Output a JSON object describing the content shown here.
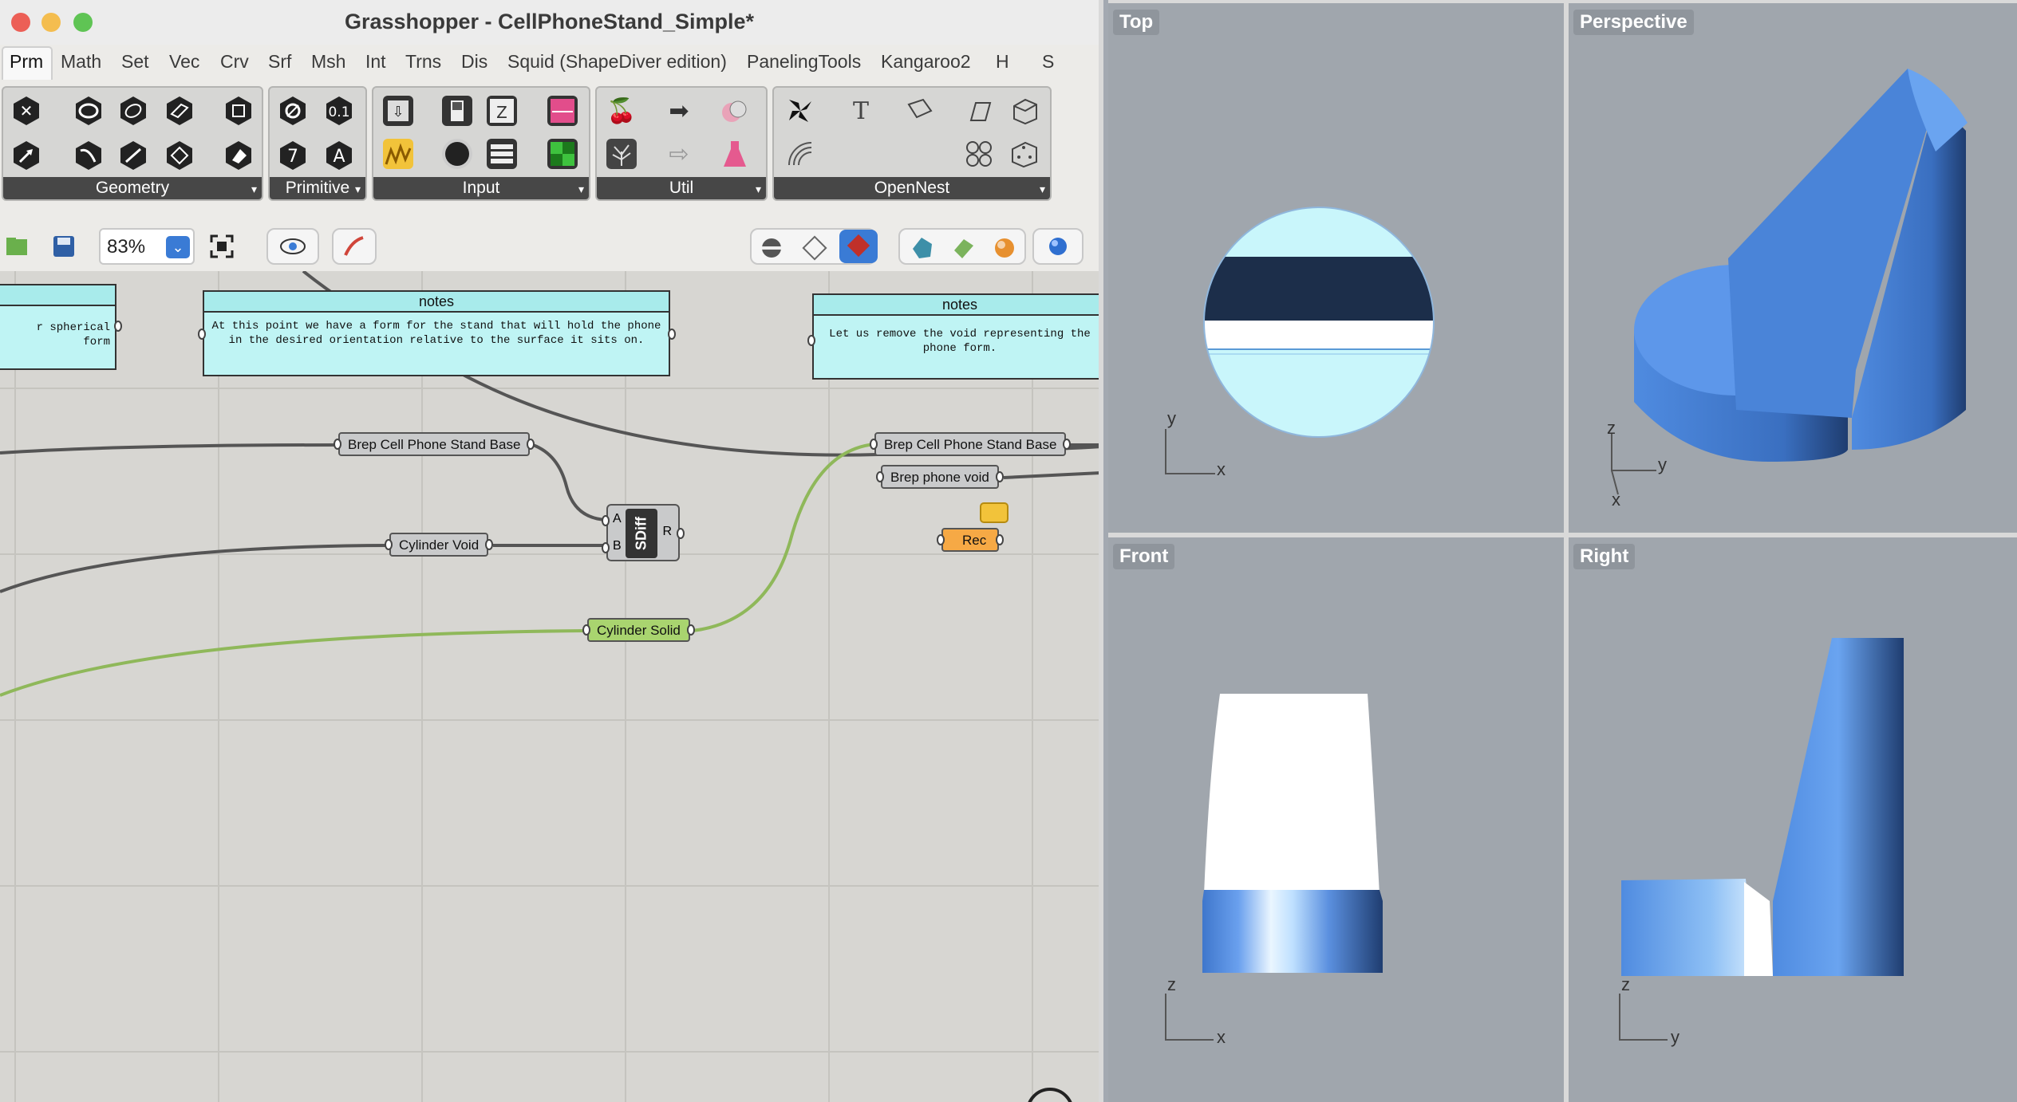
{
  "window": {
    "title": "Grasshopper - CellPhoneStand_Simple*",
    "traffic_colors": [
      "#ec5f56",
      "#f4bd4f",
      "#5fc454"
    ]
  },
  "menu": {
    "tabs": [
      "Prm",
      "Math",
      "Set",
      "Vec",
      "Crv",
      "Srf",
      "Msh",
      "Int",
      "Trns",
      "Dis",
      "Squid (ShapeDiver edition)",
      "PanelingTools",
      "Kangaroo2",
      "H",
      "S"
    ],
    "active": "Prm"
  },
  "ribbon": {
    "groups": [
      "Geometry",
      "Primitive",
      "Input",
      "Util",
      "OpenNest"
    ],
    "icons": {
      "geometry": [
        "close-icon",
        "circle-icon",
        "ring-icon",
        "plane-icon",
        "box-icon",
        "arrow-icon",
        "curve-icon",
        "line-icon",
        "diamond-icon",
        "brep-icon"
      ],
      "primitive": [
        "ring-icon",
        "decimal-icon",
        "integer-icon",
        "text-icon"
      ],
      "input": [
        "panel-icon",
        "toggle-icon",
        "slider-icon",
        "gradient-icon",
        "graph-icon",
        "button-icon",
        "list-icon",
        "swatch-icon"
      ],
      "util": [
        "cherry-icon",
        "arrow-right-icon",
        "data-icon",
        "tree-icon",
        "arrow-outline-icon",
        "flask-icon"
      ],
      "opennest": [
        "nest-icon",
        "text-tool-icon",
        "tag-icon",
        "parallelogram-icon",
        "cube-icon",
        "wifi-icon",
        "grid-icon",
        "dice-icon"
      ]
    },
    "primitive_glyphs": {
      "decimal": "0.1",
      "integer": "7",
      "text": "A"
    }
  },
  "toolbar": {
    "zoom": "83%",
    "icons": [
      "open-icon",
      "save-icon",
      "zoom-dropdown-icon",
      "zoom-extents-icon",
      "eye-icon",
      "sketch-icon",
      "preview-off-icon",
      "preview-wire-icon",
      "preview-shaded-icon",
      "bake-icon",
      "mesh-settings-icon",
      "material-icon",
      "sphere-icon"
    ]
  },
  "canvas": {
    "notes": [
      {
        "title": "",
        "body": "r spherical form"
      },
      {
        "title": "notes",
        "body": "At this point we have a form for the stand that will hold the phone in the desired orientation relative to the surface it sits on."
      },
      {
        "title": "notes",
        "body": "Let us remove the void representing the phone form."
      }
    ],
    "params": [
      {
        "label": "Brep Cell Phone Stand Base"
      },
      {
        "label": "Cylinder Void"
      },
      {
        "label": "Cylinder Solid"
      },
      {
        "label": "Brep Cell Phone Stand Base"
      },
      {
        "label": "Brep phone void"
      },
      {
        "label": "Rec"
      }
    ],
    "sdiff": {
      "label": "SDiff",
      "inputs": [
        "A",
        "B"
      ],
      "output": "R"
    },
    "colors": {
      "wire_dark": "#555555",
      "wire_green": "#8fb85a",
      "note_bg": "#bff4f4",
      "param_bg": "#c9cacb",
      "param_green": "#a9d46f",
      "param_orange": "#f6a945"
    }
  },
  "viewports": [
    {
      "name": "Top",
      "axes": [
        "y",
        "x"
      ]
    },
    {
      "name": "Perspective",
      "axes": [
        "z",
        "y",
        "x"
      ]
    },
    {
      "name": "Front",
      "axes": [
        "z",
        "x"
      ]
    },
    {
      "name": "Right",
      "axes": [
        "z",
        "y"
      ]
    }
  ]
}
